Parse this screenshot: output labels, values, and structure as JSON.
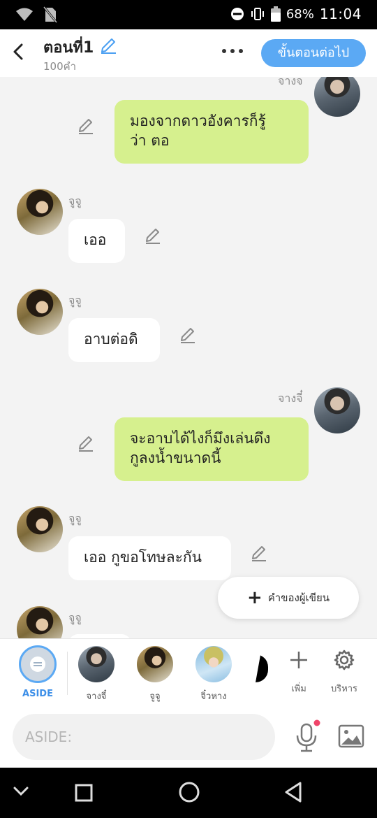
{
  "status": {
    "battery": "68%",
    "time": "11:04"
  },
  "header": {
    "title": "ตอนที่1",
    "word_count": "100คำ",
    "next_button": "ขั้นตอนต่อไป"
  },
  "messages": [
    {
      "side": "right",
      "name": "จางจ",
      "text": [
        "มองจากดาวอังคารก็รู้",
        "ว่า ตอ"
      ]
    },
    {
      "side": "left",
      "name": "จูจู",
      "text": [
        "เออ"
      ]
    },
    {
      "side": "left",
      "name": "จูจู",
      "text": [
        "อาบต่อดิ"
      ]
    },
    {
      "side": "right",
      "name": "จางจี๋",
      "text": [
        "จะอาบได้ไงก็มึงเล่นดึง",
        "กูลงน้ำขนาดนี้"
      ]
    },
    {
      "side": "left",
      "name": "จูจู",
      "text": [
        "เออ กูขอโทษละกัน"
      ]
    },
    {
      "side": "left",
      "name": "จูจู",
      "text": []
    }
  ],
  "fab": {
    "label": "คำของผู้เขียน"
  },
  "characters": [
    {
      "label": "ASIDE"
    },
    {
      "label": "จางจี๋"
    },
    {
      "label": "จูจู"
    },
    {
      "label": "จิ๋วหาง"
    }
  ],
  "tools": {
    "add": "เพิ่ม",
    "manage": "บริหาร"
  },
  "input": {
    "placeholder": "ASIDE:"
  },
  "colors": {
    "accent": "#5ba9f4",
    "bubble_right": "#d6f08e",
    "bubble_left": "#ffffff"
  }
}
